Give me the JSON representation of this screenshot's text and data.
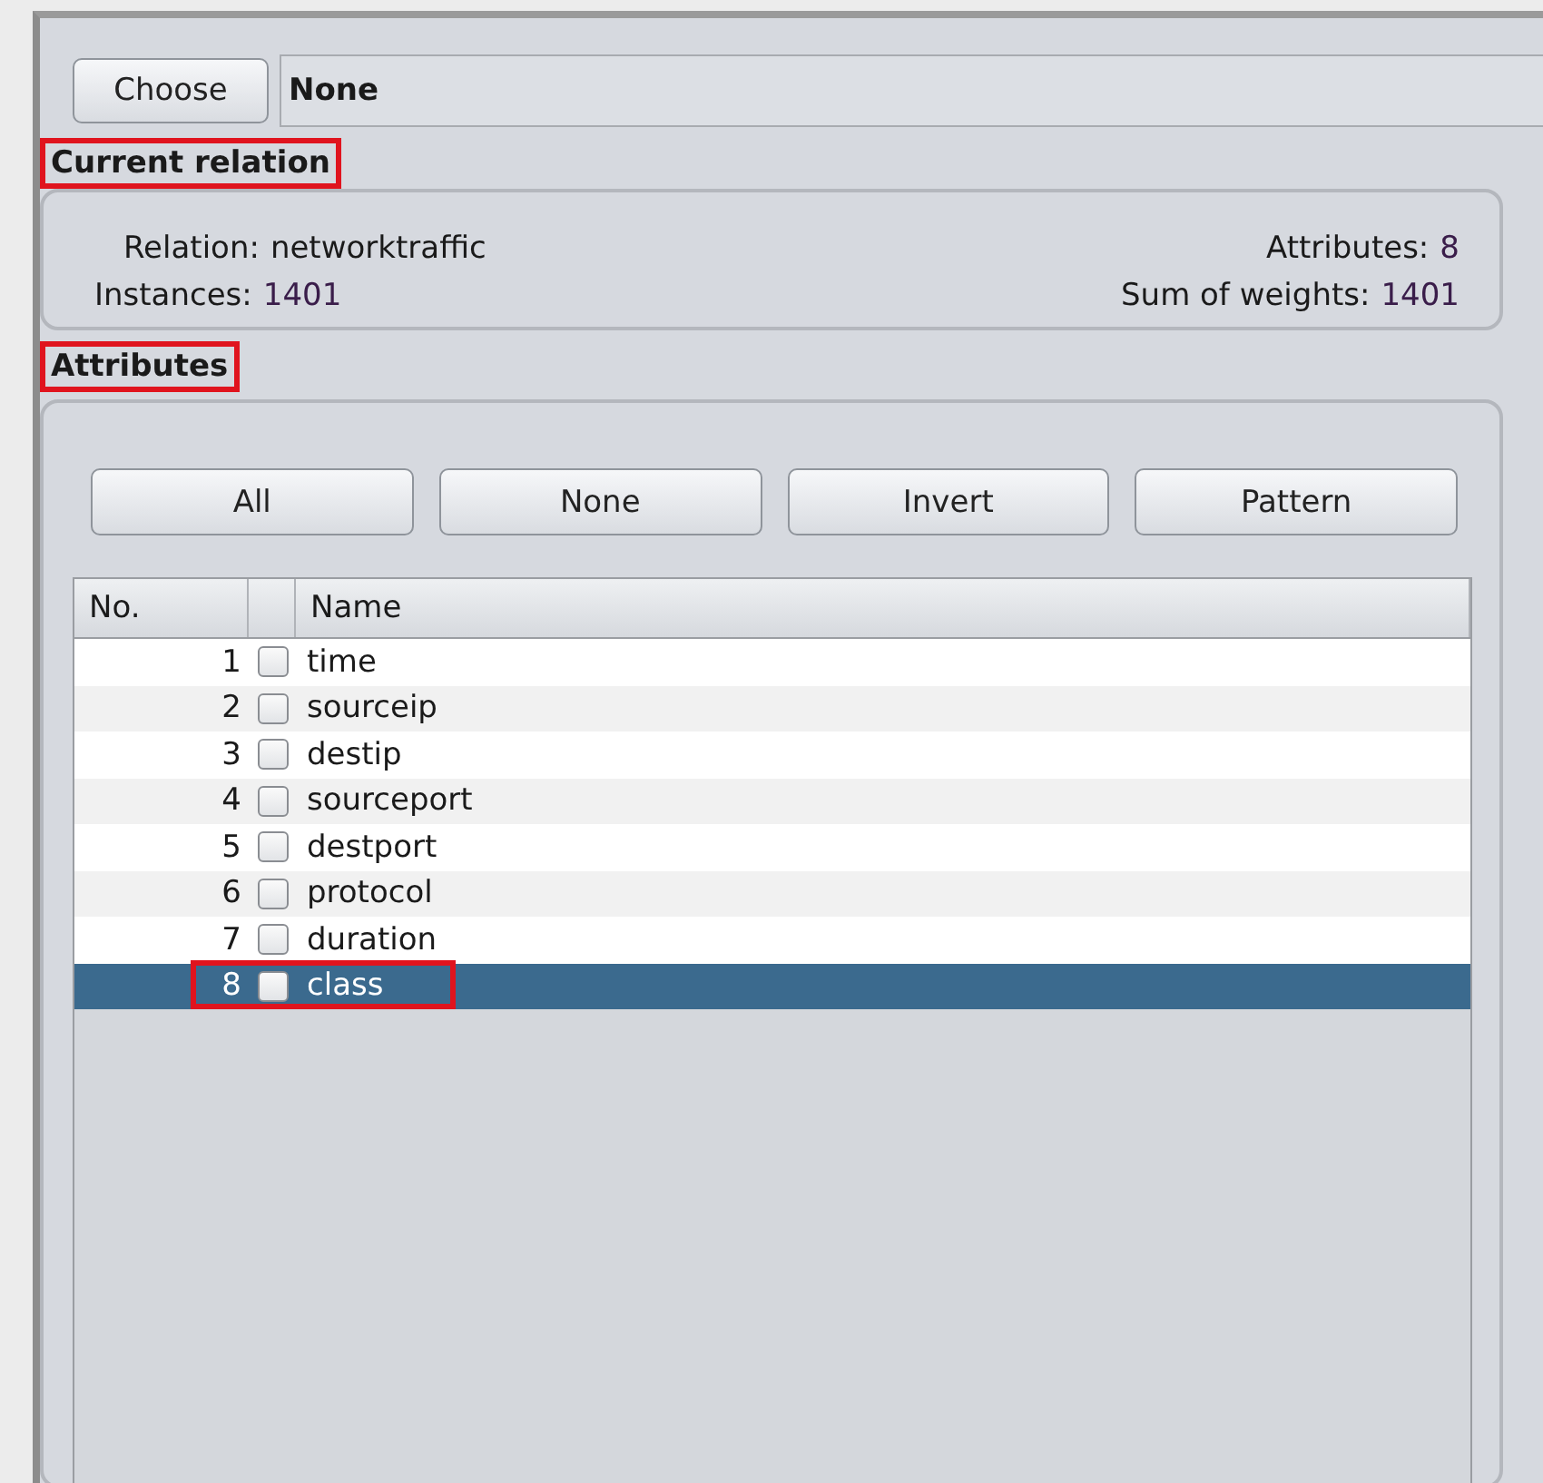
{
  "file_chooser": {
    "button": "Choose",
    "value": "None"
  },
  "current_relation": {
    "title": "Current relation",
    "highlighted": true,
    "relation_label": "Relation:",
    "relation": "networktraffic",
    "instances_label": "Instances:",
    "instances": "1401",
    "attributes_label": "Attributes:",
    "attributes": "8",
    "weights_label": "Sum of weights:",
    "weights": "1401"
  },
  "attributes": {
    "title": "Attributes",
    "highlighted": true,
    "buttons": [
      "All",
      "None",
      "Invert",
      "Pattern"
    ],
    "table": {
      "columns": [
        "No.",
        "Name"
      ],
      "rows": [
        {
          "no": "1",
          "name": "time",
          "checked": false,
          "selected": false,
          "highlighted": false
        },
        {
          "no": "2",
          "name": "sourceip",
          "checked": false,
          "selected": false,
          "highlighted": false
        },
        {
          "no": "3",
          "name": "destip",
          "checked": false,
          "selected": false,
          "highlighted": false
        },
        {
          "no": "4",
          "name": "sourceport",
          "checked": false,
          "selected": false,
          "highlighted": false
        },
        {
          "no": "5",
          "name": "destport",
          "checked": false,
          "selected": false,
          "highlighted": false
        },
        {
          "no": "6",
          "name": "protocol",
          "checked": false,
          "selected": false,
          "highlighted": false
        },
        {
          "no": "7",
          "name": "duration",
          "checked": false,
          "selected": false,
          "highlighted": false
        },
        {
          "no": "8",
          "name": "class",
          "checked": false,
          "selected": true,
          "highlighted": true
        }
      ]
    }
  }
}
